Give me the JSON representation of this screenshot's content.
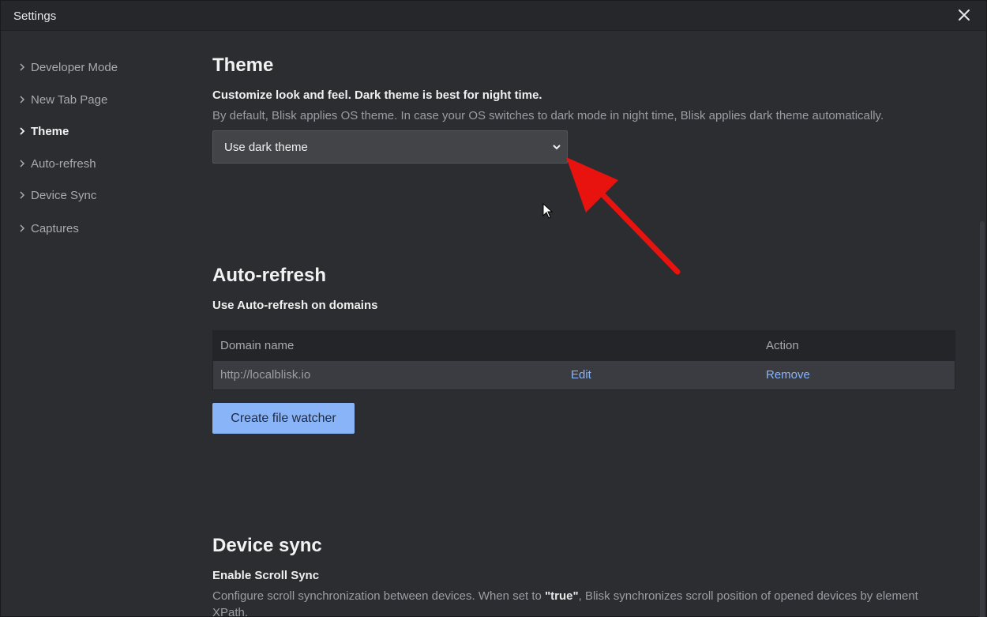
{
  "window": {
    "title": "Settings"
  },
  "sidebar": {
    "items": [
      {
        "label": "Developer Mode",
        "active": false
      },
      {
        "label": "New Tab Page",
        "active": false
      },
      {
        "label": "Theme",
        "active": true
      },
      {
        "label": "Auto-refresh",
        "active": false
      },
      {
        "label": "Device Sync",
        "active": false
      },
      {
        "label": "Captures",
        "active": false
      }
    ]
  },
  "theme": {
    "heading": "Theme",
    "subheading": "Customize look and feel. Dark theme is best for night time.",
    "description": "By default, Blisk applies OS theme. In case your OS switches to dark mode in night time, Blisk applies dark theme automatically.",
    "select_value": "Use dark theme"
  },
  "autorefresh": {
    "heading": "Auto-refresh",
    "subheading": "Use Auto-refresh on domains",
    "table": {
      "columns": [
        "Domain name",
        "Action"
      ],
      "rows": [
        {
          "domain": "http://localblisk.io",
          "edit": "Edit",
          "remove": "Remove"
        }
      ]
    },
    "button_label": "Create file watcher"
  },
  "devicesync": {
    "heading": "Device sync",
    "subheading": "Enable Scroll Sync",
    "description_before": "Configure scroll synchronization between devices. When set to ",
    "description_highlight": "\"true\"",
    "description_after": ", Blisk synchronizes scroll position of opened devices by element XPath."
  },
  "colors": {
    "background": "#2c2d31",
    "accent": "#8ab4f8",
    "annotation_arrow": "#e8120f"
  }
}
